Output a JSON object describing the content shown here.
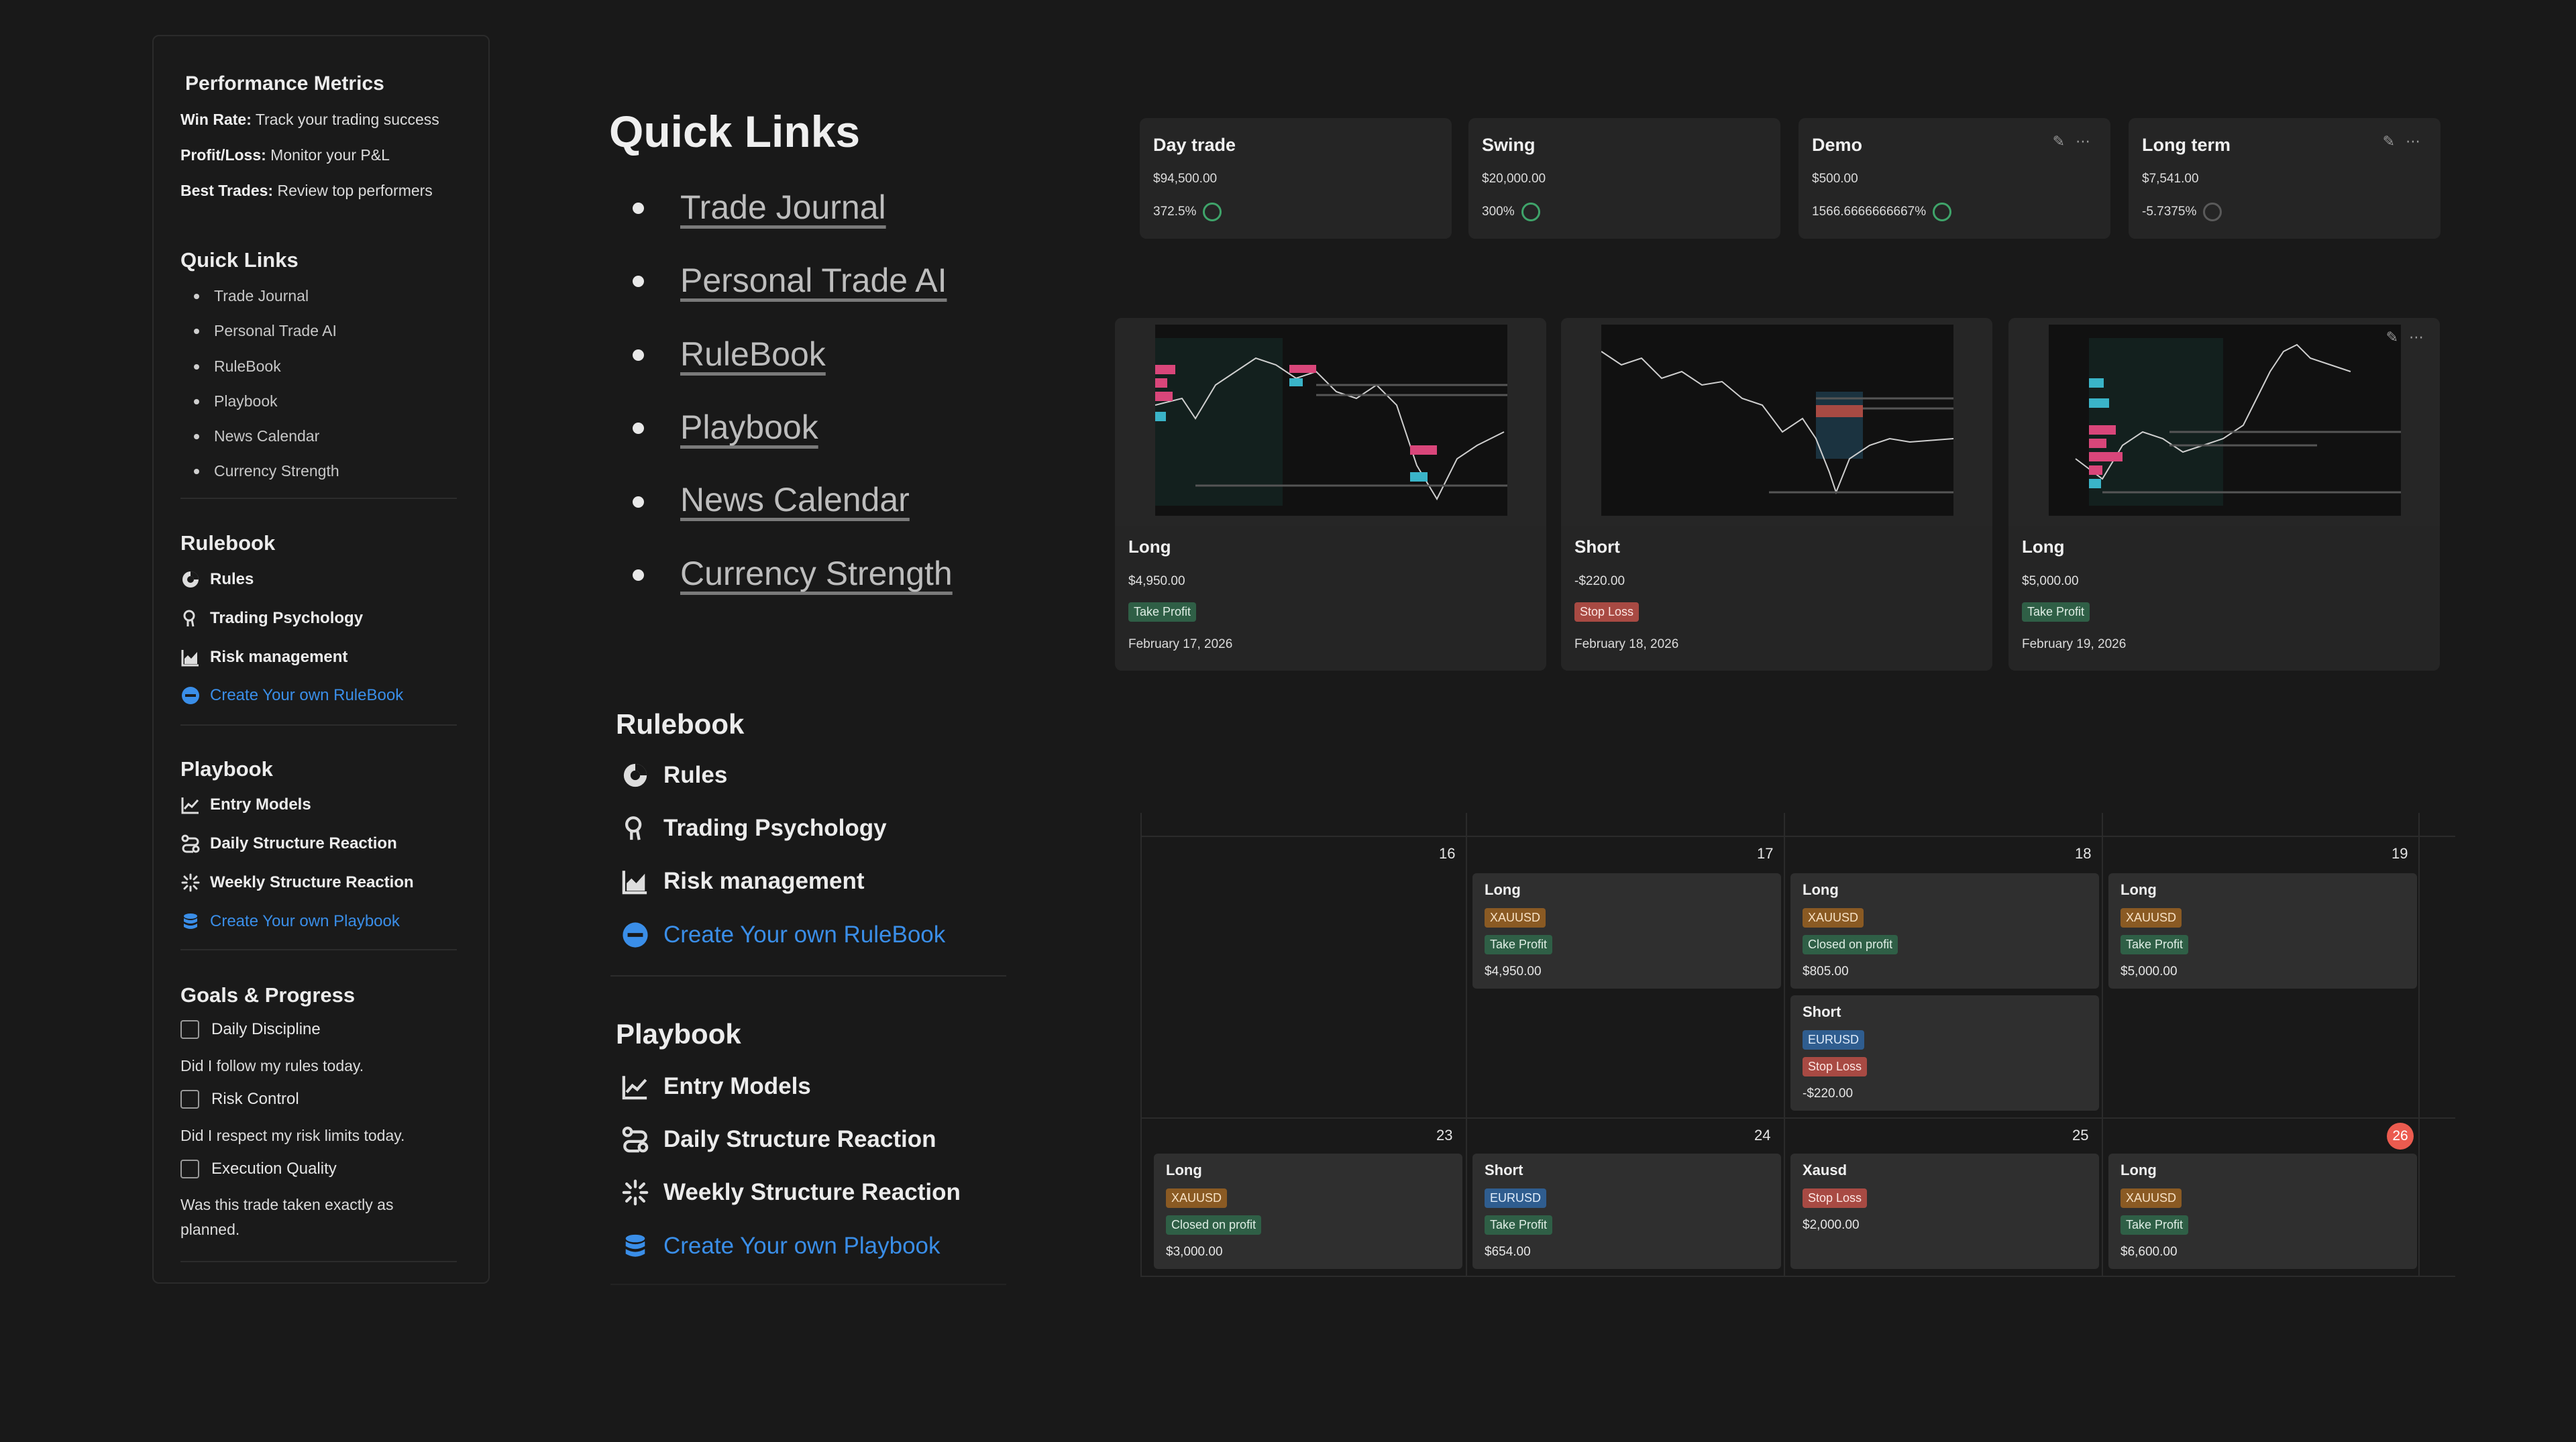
{
  "sidebar": {
    "metrics_title": "Performance Metrics",
    "metrics": [
      {
        "label": "Win Rate:",
        "text": " Track your trading success"
      },
      {
        "label": "Profit/Loss:",
        "text": " Monitor your P&L"
      },
      {
        "label": "Best Trades:",
        "text": " Review top performers"
      }
    ],
    "quick_links_title": "Quick Links",
    "quick_links": [
      "Trade Journal",
      "Personal Trade AI",
      "RuleBook",
      "Playbook",
      "News Calendar",
      "Currency Strength"
    ],
    "rulebook_title": "Rulebook",
    "rulebook_items": [
      "Rules",
      "Trading Psychology",
      "Risk management"
    ],
    "rulebook_create": "Create Your own RuleBook",
    "playbook_title": "Playbook",
    "playbook_items": [
      "Entry Models",
      "Daily Structure Reaction",
      "Weekly Structure Reaction"
    ],
    "playbook_create": "Create Your own Playbook",
    "goals_title": "Goals & Progress",
    "goals": [
      {
        "label": "Daily Discipline",
        "question": "Did I follow my rules today."
      },
      {
        "label": "Risk Control",
        "question": "Did I respect my risk limits today."
      },
      {
        "label": "Execution Quality",
        "question": "Was this trade taken exactly as planned."
      }
    ]
  },
  "main": {
    "quick_links_title": "Quick Links",
    "quick_links": [
      "Trade Journal",
      "Personal Trade AI",
      "RuleBook",
      "Playbook",
      "News Calendar",
      "Currency Strength"
    ],
    "rulebook_title": "Rulebook",
    "rulebook_items": [
      "Rules",
      "Trading Psychology",
      "Risk management"
    ],
    "rulebook_create": "Create Your own RuleBook",
    "playbook_title": "Playbook",
    "playbook_items": [
      "Entry Models",
      "Daily Structure Reaction",
      "Weekly Structure Reaction"
    ],
    "playbook_create": "Create Your own Playbook"
  },
  "accounts": [
    {
      "name": "Day trade",
      "balance": "$94,500.00",
      "return": "372.5%",
      "ring_color": "#3fa46a"
    },
    {
      "name": "Swing",
      "balance": "$20,000.00",
      "return": "300%",
      "ring_color": "#3fa46a"
    },
    {
      "name": "Demo",
      "balance": "$500.00",
      "return": "1566.6666666667%",
      "ring_color": "#3fa46a"
    },
    {
      "name": "Long term",
      "balance": "$7,541.00",
      "return": "-5.7375%",
      "ring_color": "#5a5a5a"
    }
  ],
  "trades": [
    {
      "side": "Long",
      "amount": "$4,950.00",
      "result": "Take Profit",
      "date": "February 17, 2026"
    },
    {
      "side": "Short",
      "amount": "-$220.00",
      "result": "Stop Loss",
      "date": "February 18, 2026"
    },
    {
      "side": "Long",
      "amount": "$5,000.00",
      "result": "Take Profit",
      "date": "February 19, 2026"
    }
  ],
  "calendar": {
    "week1_days": [
      "16",
      "17",
      "18",
      "19"
    ],
    "week2_days": [
      "23",
      "24",
      "25",
      "26"
    ],
    "events": {
      "d17": {
        "side": "Long",
        "pair": "XAUUSD",
        "result": "Take Profit",
        "amount": "$4,950.00"
      },
      "d18a": {
        "side": "Long",
        "pair": "XAUUSD",
        "result": "Closed on profit",
        "amount": "$805.00"
      },
      "d18b": {
        "side": "Short",
        "pair": "EURUSD",
        "result": "Stop Loss",
        "amount": "-$220.00"
      },
      "d19": {
        "side": "Long",
        "pair": "XAUUSD",
        "result": "Take Profit",
        "amount": "$5,000.00"
      },
      "d23": {
        "side": "Long",
        "pair": "XAUUSD",
        "result": "Closed on profit",
        "amount": "$3,000.00"
      },
      "d24": {
        "side": "Short",
        "pair": "EURUSD",
        "result": "Take Profit",
        "amount": "$654.00"
      },
      "d25": {
        "side": "Xausd",
        "result": "Stop Loss",
        "amount": "$2,000.00"
      },
      "d26": {
        "side": "Long",
        "pair": "XAUUSD",
        "result": "Take Profit",
        "amount": "$6,600.00"
      }
    }
  },
  "colors": {
    "accent_blue": "#3a8ee8",
    "tp_green": "#2f5f46",
    "sl_red": "#a84a43",
    "pair_orange": "#8a5a23",
    "pair_blue": "#2f5d8f",
    "today_red": "#eb5b4f"
  }
}
